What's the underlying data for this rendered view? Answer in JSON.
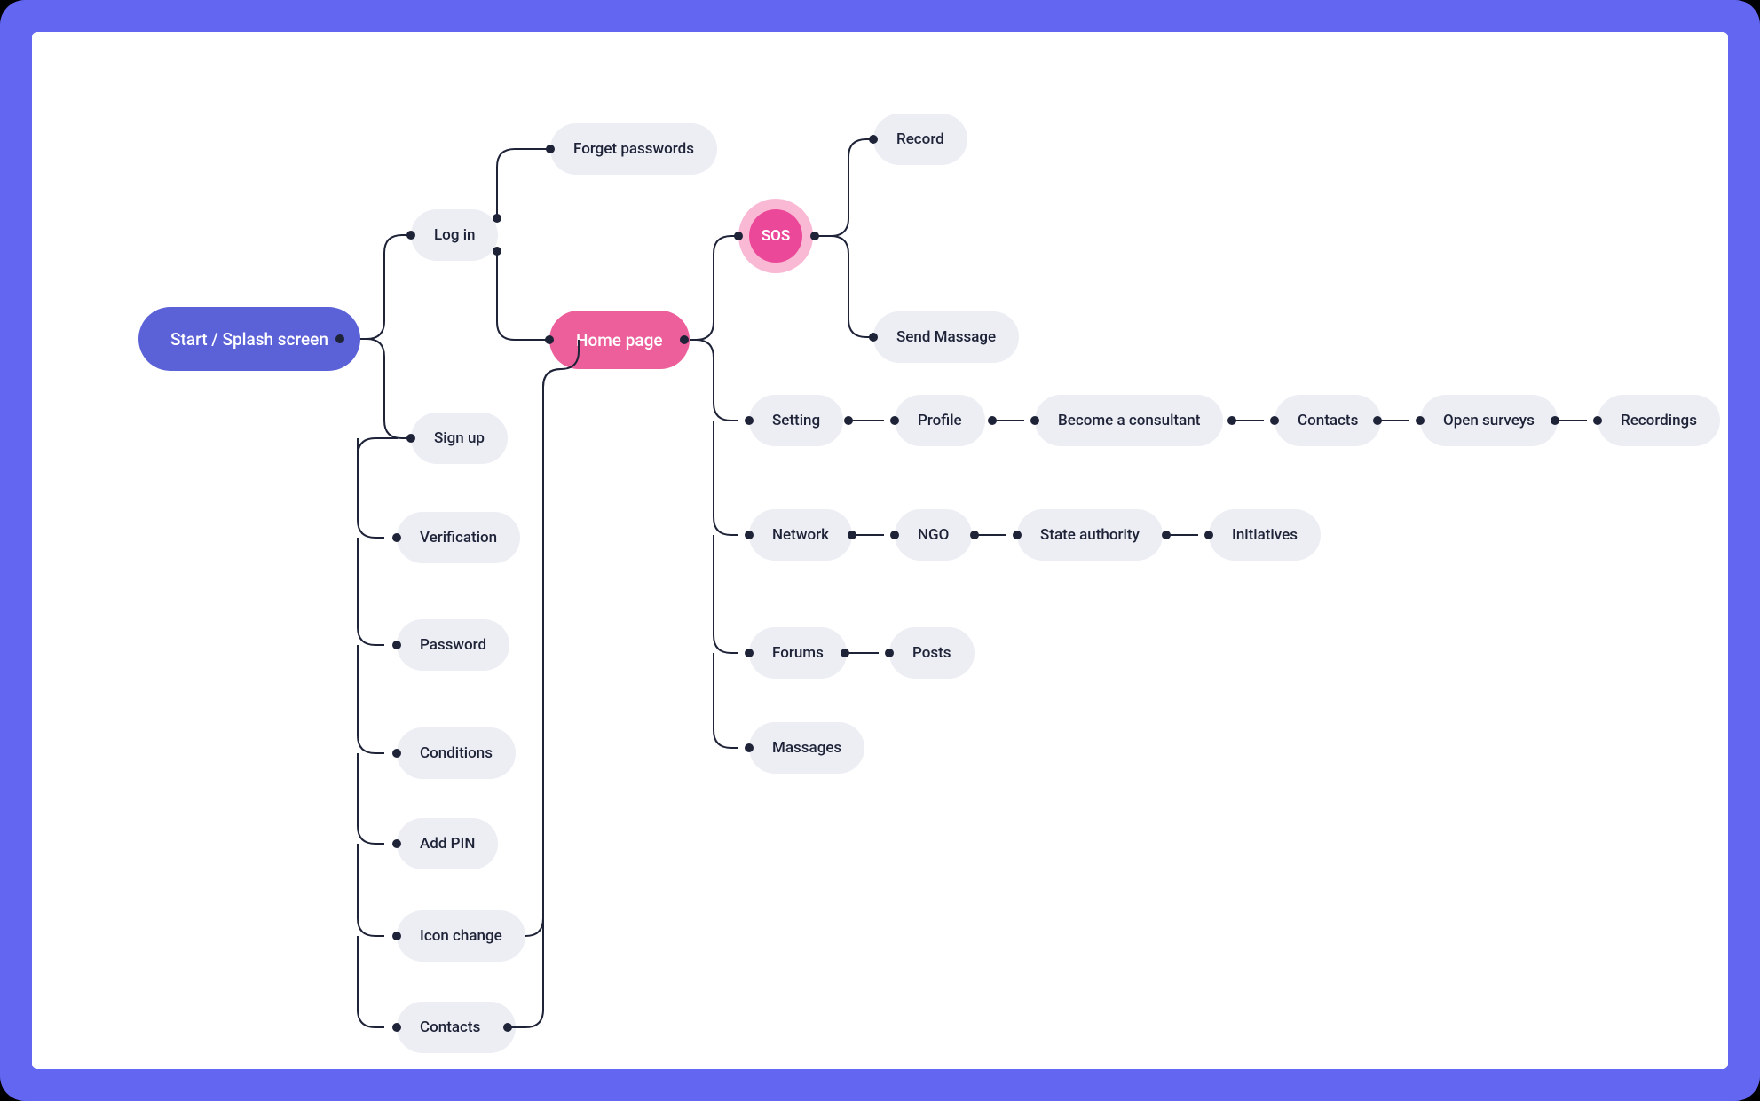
{
  "colors": {
    "frame": "#6366f1",
    "canvas": "#ffffff",
    "nodeDefaultBg": "#eceef4",
    "nodeDefaultFg": "#1e2338",
    "nodePrimaryBg": "#5b61d6",
    "nodeAccentBg": "#ec5f9b",
    "sosOuter": "#f9b8d3",
    "sosInner": "#ec4899",
    "line": "#1e2338"
  },
  "nodes": {
    "start": {
      "label": "Start / Splash screen",
      "variant": "primary"
    },
    "login": {
      "label": "Log in"
    },
    "signup": {
      "label": "Sign up"
    },
    "forgot": {
      "label": "Forget passwords"
    },
    "verification": {
      "label": "Verification"
    },
    "password": {
      "label": "Password"
    },
    "conditions": {
      "label": "Conditions"
    },
    "addpin": {
      "label": "Add PIN"
    },
    "iconchange": {
      "label": "Icon change"
    },
    "contacts1": {
      "label": "Contacts"
    },
    "home": {
      "label": "Home page",
      "variant": "accent"
    },
    "sos": {
      "label": "SOS",
      "variant": "sos"
    },
    "record": {
      "label": "Record"
    },
    "sendmsg": {
      "label": "Send Massage"
    },
    "setting": {
      "label": "Setting"
    },
    "profile": {
      "label": "Profile"
    },
    "become": {
      "label": "Become a consultant"
    },
    "contacts2": {
      "label": "Contacts"
    },
    "surveys": {
      "label": "Open surveys"
    },
    "recordings": {
      "label": "Recordings"
    },
    "network": {
      "label": "Network"
    },
    "ngo": {
      "label": "NGO"
    },
    "stateauth": {
      "label": "State authority"
    },
    "initiatives": {
      "label": "Initiatives"
    },
    "forums": {
      "label": "Forums"
    },
    "posts": {
      "label": "Posts"
    },
    "massages": {
      "label": "Massages"
    }
  }
}
